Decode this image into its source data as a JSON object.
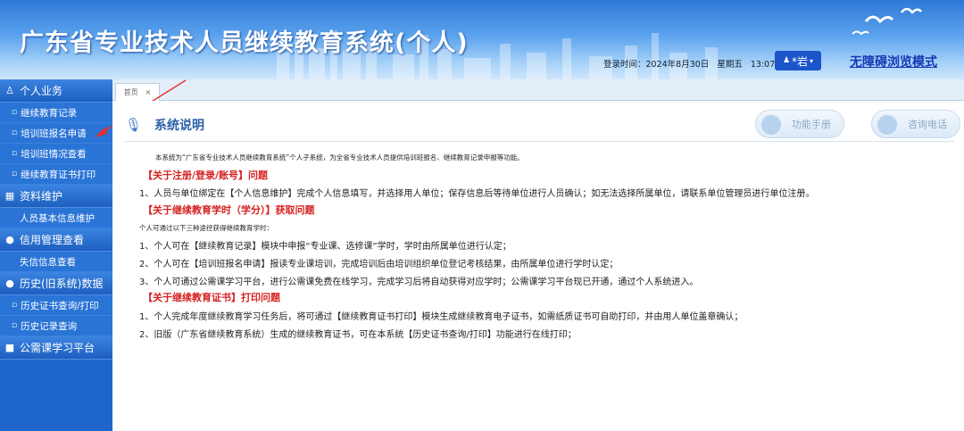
{
  "header": {
    "title": "广东省专业技术人员继续教育系统(个人)",
    "login_time_label": "登录时间：2024年8月30日",
    "weekday": "星期五",
    "clock": "13:07:04",
    "user": "*岩",
    "accessibility": "无障碍浏览模式"
  },
  "sidebar": {
    "sections": [
      {
        "label": "个人业务",
        "items": [
          "继续教育记录",
          "培训班报名申请",
          "培训班情况查看",
          "继续教育证书打印"
        ]
      },
      {
        "label": "资料维护",
        "items": [
          "人员基本信息维护"
        ]
      },
      {
        "label": "信用管理查看",
        "items": [
          "失信信息查看"
        ]
      },
      {
        "label": "历史(旧系统)数据",
        "items": [
          "历史证书查询/打印",
          "历史记录查询"
        ]
      },
      {
        "label": "公需课学习平台",
        "items": []
      }
    ]
  },
  "tabs": [
    {
      "label": "首页",
      "close": "×"
    }
  ],
  "content": {
    "heading": "系统说明",
    "btn_manual": "功能手册",
    "btn_phone": "咨询电话",
    "intro": "本系统为“广东省专业技术人员继续教育系统”个人子系统，为全省专业技术人员提供培训班报名、继续教育记录申报等功能。",
    "sec1": "【关于注册/登录/账号】问题",
    "sec1_p1": "1、人员与单位绑定在【个人信息维护】完成个人信息填写，并选择用人单位；保存信息后等待单位进行人员确认；如无法选择所属单位，请联系单位管理员进行单位注册。",
    "sec2": "【关于继续教育学时（学分）】获取问题",
    "sec2_note": "个人可通过以下三种途径获得继续教育学时：",
    "sec2_p1": "1、个人可在【继续教育记录】模块中申报“专业课、选修课”学时，学时由所属单位进行认定；",
    "sec2_p2": "2、个人可在【培训班报名申请】报读专业课培训，完成培训后由培训组织单位登记考核结果，由所属单位进行学时认定；",
    "sec2_p3": "3、个人可通过公需课学习平台，进行公需课免费在线学习，完成学习后将自动获得对应学时；公需课学习平台现已开通，通过个人系统进入。",
    "sec3": "【关于继续教育证书】打印问题",
    "sec3_p1": "1、个人完成年度继续教育学习任务后，将可通过【继续教育证书打印】模块生成继续教育电子证书，如需纸质证书可自助打印，并由用人单位盖章确认；",
    "sec3_p2": "2、旧版（广东省继续教育系统）生成的继续教育证书，可在本系统【历史证书查询/打印】功能进行在线打印；"
  }
}
